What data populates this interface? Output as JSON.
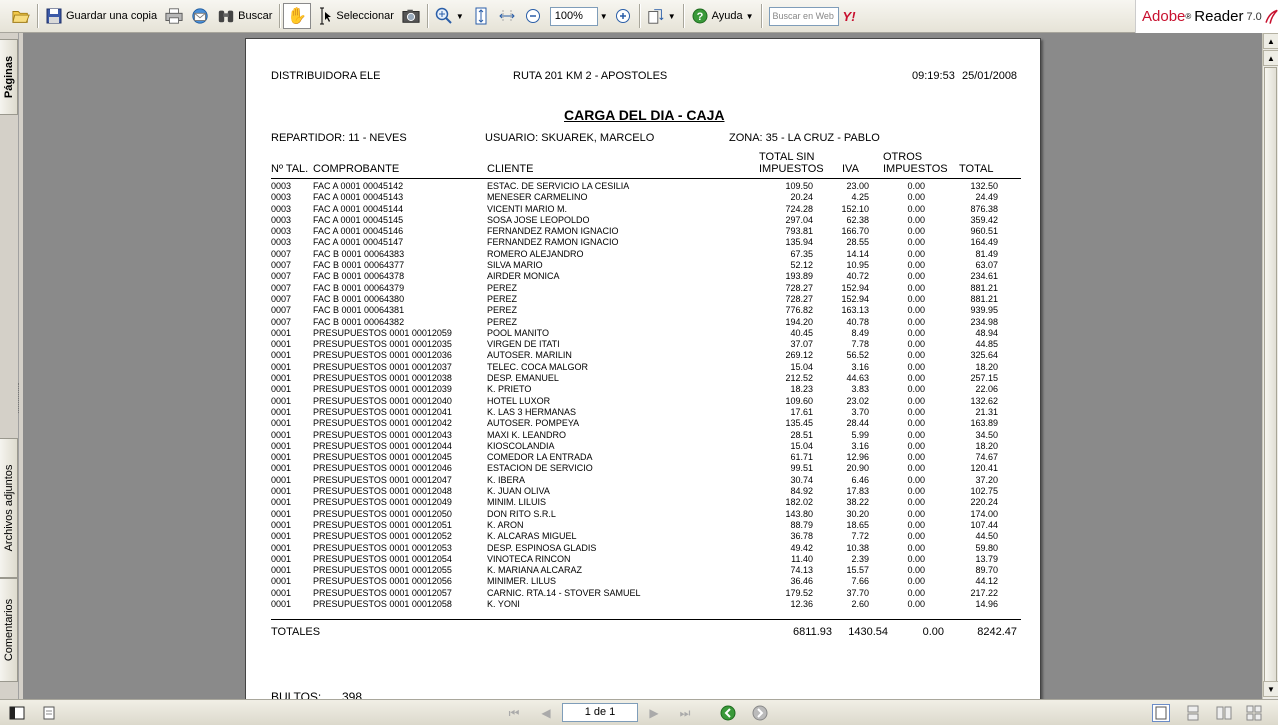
{
  "toolbar": {
    "save_copy_label": "Guardar una copia",
    "search_label": "Buscar",
    "select_label": "Seleccionar",
    "zoom_value": "100%",
    "help_label": "Ayuda",
    "web_search_placeholder": "Buscar en Web",
    "yahoo_label": "Y!",
    "brand": "Adobe",
    "product": "Reader",
    "version": "7.0"
  },
  "side_tabs": {
    "pages": "Páginas",
    "attachments": "Archivos adjuntos",
    "comments": "Comentarios"
  },
  "report": {
    "company": "DISTRIBUIDORA ELE",
    "address": "RUTA 201 KM 2 - APOSTOLES",
    "time": "09:19:53",
    "date": "25/01/2008",
    "title": "CARGA DEL DIA - CAJA",
    "repartidor": "REPARTIDOR: 11 - NEVES",
    "usuario": "USUARIO: SKUAREK, MARCELO",
    "zona": "ZONA: 35 - LA CRUZ - PABLO",
    "headers": {
      "tal": "Nº TAL.",
      "comprobante": "COMPROBANTE",
      "cliente": "CLIENTE",
      "total_sin_1": "TOTAL SIN",
      "total_sin_2": "IMPUESTOS",
      "iva": "IVA",
      "otros_1": "OTROS",
      "otros_2": "IMPUESTOS",
      "total": "TOTAL"
    },
    "rows": [
      [
        "0003",
        "FAC A 0001 00045142",
        "ESTAC. DE SERVICIO LA CESILIA",
        "109.50",
        "23.00",
        "0.00",
        "132.50"
      ],
      [
        "0003",
        "FAC A 0001 00045143",
        "MENESER CARMELINO",
        "20.24",
        "4.25",
        "0.00",
        "24.49"
      ],
      [
        "0003",
        "FAC A 0001 00045144",
        "VICENTI MARIO M.",
        "724.28",
        "152.10",
        "0.00",
        "876.38"
      ],
      [
        "0003",
        "FAC A 0001 00045145",
        "SOSA JOSE LEOPOLDO",
        "297.04",
        "62.38",
        "0.00",
        "359.42"
      ],
      [
        "0003",
        "FAC A 0001 00045146",
        "FERNANDEZ RAMON IGNACIO",
        "793.81",
        "166.70",
        "0.00",
        "960.51"
      ],
      [
        "0003",
        "FAC A 0001 00045147",
        "FERNANDEZ RAMON IGNACIO",
        "135.94",
        "28.55",
        "0.00",
        "164.49"
      ],
      [
        "0007",
        "FAC B 0001 00064383",
        "ROMERO ALEJANDRO",
        "67.35",
        "14.14",
        "0.00",
        "81.49"
      ],
      [
        "0007",
        "FAC B 0001 00064377",
        "SILVA MARIO",
        "52.12",
        "10.95",
        "0.00",
        "63.07"
      ],
      [
        "0007",
        "FAC B 0001 00064378",
        "AIRDER MONICA",
        "193.89",
        "40.72",
        "0.00",
        "234.61"
      ],
      [
        "0007",
        "FAC B 0001 00064379",
        "PEREZ",
        "728.27",
        "152.94",
        "0.00",
        "881.21"
      ],
      [
        "0007",
        "FAC B 0001 00064380",
        "PEREZ",
        "728.27",
        "152.94",
        "0.00",
        "881.21"
      ],
      [
        "0007",
        "FAC B 0001 00064381",
        "PEREZ",
        "776.82",
        "163.13",
        "0.00",
        "939.95"
      ],
      [
        "0007",
        "FAC B 0001 00064382",
        "PEREZ",
        "194.20",
        "40.78",
        "0.00",
        "234.98"
      ],
      [
        "0001",
        "PRESUPUESTOS 0001 00012059",
        "POOL MANITO",
        "40.45",
        "8.49",
        "0.00",
        "48.94"
      ],
      [
        "0001",
        "PRESUPUESTOS 0001 00012035",
        "VIRGEN DE ITATI",
        "37.07",
        "7.78",
        "0.00",
        "44.85"
      ],
      [
        "0001",
        "PRESUPUESTOS 0001 00012036",
        "AUTOSER. MARILIN",
        "269.12",
        "56.52",
        "0.00",
        "325.64"
      ],
      [
        "0001",
        "PRESUPUESTOS 0001 00012037",
        "TELEC. COCA MALGOR",
        "15.04",
        "3.16",
        "0.00",
        "18.20"
      ],
      [
        "0001",
        "PRESUPUESTOS 0001 00012038",
        "DESP. EMANUEL",
        "212.52",
        "44.63",
        "0.00",
        "257.15"
      ],
      [
        "0001",
        "PRESUPUESTOS 0001 00012039",
        "K. PRIETO",
        "18.23",
        "3.83",
        "0.00",
        "22.06"
      ],
      [
        "0001",
        "PRESUPUESTOS 0001 00012040",
        "HOTEL LUXOR",
        "109.60",
        "23.02",
        "0.00",
        "132.62"
      ],
      [
        "0001",
        "PRESUPUESTOS 0001 00012041",
        "K. LAS 3 HERMANAS",
        "17.61",
        "3.70",
        "0.00",
        "21.31"
      ],
      [
        "0001",
        "PRESUPUESTOS 0001 00012042",
        "AUTOSER. POMPEYA",
        "135.45",
        "28.44",
        "0.00",
        "163.89"
      ],
      [
        "0001",
        "PRESUPUESTOS 0001 00012043",
        "MAXI K. LEANDRO",
        "28.51",
        "5.99",
        "0.00",
        "34.50"
      ],
      [
        "0001",
        "PRESUPUESTOS 0001 00012044",
        "KIOSCOLANDIA",
        "15.04",
        "3.16",
        "0.00",
        "18.20"
      ],
      [
        "0001",
        "PRESUPUESTOS 0001 00012045",
        "COMEDOR LA ENTRADA",
        "61.71",
        "12.96",
        "0.00",
        "74.67"
      ],
      [
        "0001",
        "PRESUPUESTOS 0001 00012046",
        "ESTACION DE SERVICIO",
        "99.51",
        "20.90",
        "0.00",
        "120.41"
      ],
      [
        "0001",
        "PRESUPUESTOS 0001 00012047",
        "K. IBERA",
        "30.74",
        "6.46",
        "0.00",
        "37.20"
      ],
      [
        "0001",
        "PRESUPUESTOS 0001 00012048",
        "K. JUAN OLIVA",
        "84.92",
        "17.83",
        "0.00",
        "102.75"
      ],
      [
        "0001",
        "PRESUPUESTOS 0001 00012049",
        "MINIM. LILUIS",
        "182.02",
        "38.22",
        "0.00",
        "220.24"
      ],
      [
        "0001",
        "PRESUPUESTOS 0001 00012050",
        "DON RITO S.R.L",
        "143.80",
        "30.20",
        "0.00",
        "174.00"
      ],
      [
        "0001",
        "PRESUPUESTOS 0001 00012051",
        "K. ARON",
        "88.79",
        "18.65",
        "0.00",
        "107.44"
      ],
      [
        "0001",
        "PRESUPUESTOS 0001 00012052",
        "K. ALCARAS MIGUEL",
        "36.78",
        "7.72",
        "0.00",
        "44.50"
      ],
      [
        "0001",
        "PRESUPUESTOS 0001 00012053",
        "DESP. ESPINOSA GLADIS",
        "49.42",
        "10.38",
        "0.00",
        "59.80"
      ],
      [
        "0001",
        "PRESUPUESTOS 0001 00012054",
        "VINOTECA RINCON",
        "11.40",
        "2.39",
        "0.00",
        "13.79"
      ],
      [
        "0001",
        "PRESUPUESTOS 0001 00012055",
        "K. MARIANA ALCARAZ",
        "74.13",
        "15.57",
        "0.00",
        "89.70"
      ],
      [
        "0001",
        "PRESUPUESTOS 0001 00012056",
        "MINIMER. LILUS",
        "36.46",
        "7.66",
        "0.00",
        "44.12"
      ],
      [
        "0001",
        "PRESUPUESTOS 0001 00012057",
        "CARNIC. RTA.14 - STOVER SAMUEL",
        "179.52",
        "37.70",
        "0.00",
        "217.22"
      ],
      [
        "0001",
        "PRESUPUESTOS 0001 00012058",
        "K. YONI",
        "12.36",
        "2.60",
        "0.00",
        "14.96"
      ]
    ],
    "totals_label": "TOTALES",
    "totals": {
      "net": "6811.93",
      "iva": "1430.54",
      "otros": "0.00",
      "total": "8242.47"
    },
    "bultos_label": "BULTOS:",
    "bultos_value": "398"
  },
  "statusbar": {
    "page_indicator": "1 de 1"
  }
}
